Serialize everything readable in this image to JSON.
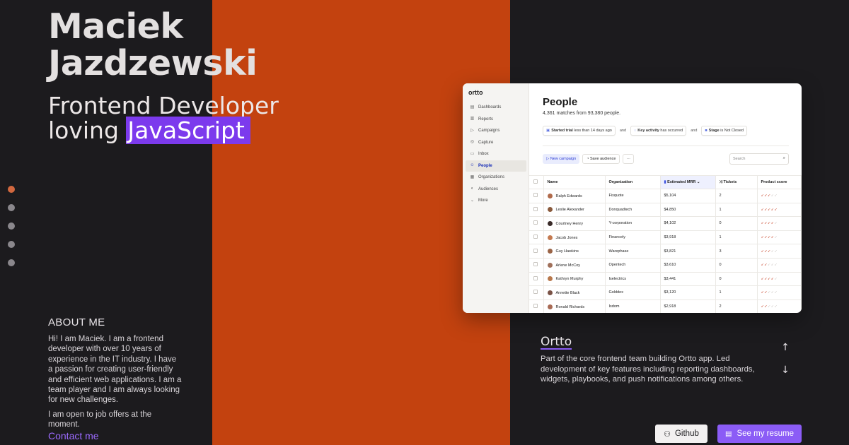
{
  "hero": {
    "first_name": "Maciek",
    "last_name": "Jazdzewski",
    "role_line1": "Frontend Developer",
    "role_line2_prefix": "loving ",
    "role_highlight": "JavaScript"
  },
  "pager": {
    "dots": 5,
    "active_index": 0
  },
  "about": {
    "title": "ABOUT ME",
    "paragraph1": "Hi! I am Maciek. I am a frontend developer with over 10 years of experience in the IT industry. I have a passion for creating user-friendly and efficient web applications. I am a team player and I am always looking for new challenges.",
    "paragraph2": "I am open to job offers at the moment.",
    "contact_label": "Contact me"
  },
  "app": {
    "logo": "ortto",
    "nav": [
      {
        "label": "Dashboards",
        "icon": "dashboard-icon",
        "glyph": "▤"
      },
      {
        "label": "Reports",
        "icon": "reports-icon",
        "glyph": "▥"
      },
      {
        "label": "Campaigns",
        "icon": "campaigns-icon",
        "glyph": "▷"
      },
      {
        "label": "Capture",
        "icon": "capture-icon",
        "glyph": "◎"
      },
      {
        "label": "Inbox",
        "icon": "inbox-icon",
        "glyph": "▭"
      },
      {
        "label": "People",
        "icon": "people-icon",
        "glyph": "☺",
        "active": true
      },
      {
        "label": "Organizations",
        "icon": "organizations-icon",
        "glyph": "▦"
      },
      {
        "label": "Audiences",
        "icon": "audiences-icon",
        "glyph": "◐"
      },
      {
        "label": "More",
        "icon": "chevron-down-icon",
        "glyph": "⌄"
      }
    ],
    "title": "People",
    "subtitle": "4,361 matches from 93,380 people.",
    "filters": [
      {
        "bold": "Started trial",
        "rest": " less than 14 days ago"
      },
      {
        "bold": "Key activity",
        "rest": " has occurred"
      },
      {
        "bold": "Stage",
        "rest": " is Not Closed"
      }
    ],
    "filter_joiner": "and",
    "new_campaign_label": "New campaign",
    "save_audience_label": "Save audience",
    "more_label": "···",
    "search_placeholder": "Search",
    "columns": [
      "Name",
      "Organization",
      "Estimated MRR",
      "Tickets",
      "Product score"
    ],
    "rows": [
      {
        "name": "Ralph Edwards",
        "org": "Fixquote",
        "mrr": "$5,104",
        "tickets": "2",
        "score": 3
      },
      {
        "name": "Leslie Alexander",
        "org": "Donquadtech",
        "mrr": "$4,850",
        "tickets": "1",
        "score": 5
      },
      {
        "name": "Courtney Henry",
        "org": "Y-corporation",
        "mrr": "$4,102",
        "tickets": "0",
        "score": 4
      },
      {
        "name": "Jacob Jones",
        "org": "Financely",
        "mrr": "$3,918",
        "tickets": "1",
        "score": 4
      },
      {
        "name": "Guy Hawkins",
        "org": "Warephase",
        "mrr": "$3,821",
        "tickets": "3",
        "score": 3
      },
      {
        "name": "Arlene McCoy",
        "org": "Opentech",
        "mrr": "$3,610",
        "tickets": "0",
        "score": 2
      },
      {
        "name": "Kathryn Murphy",
        "org": "Iselectrics",
        "mrr": "$3,441",
        "tickets": "0",
        "score": 4
      },
      {
        "name": "Annette Black",
        "org": "Golddex",
        "mrr": "$3,120",
        "tickets": "1",
        "score": 2
      },
      {
        "name": "Ronald Richards",
        "org": "Isdom",
        "mrr": "$2,918",
        "tickets": "2",
        "score": 2
      }
    ],
    "score_max": 5
  },
  "project": {
    "title": "Ortto",
    "description": "Part of the core frontend team building Ortto app. Led development of key features including reporting dashboards, widgets, playbooks, and push notifications among others."
  },
  "buttons": {
    "github_label": "Github",
    "resume_label": "See my resume"
  },
  "colors": {
    "background": "#1c1b1e",
    "accent_orange": "#c3420f",
    "accent_purple": "#8b5cf6",
    "highlight": "#7c3aed"
  }
}
